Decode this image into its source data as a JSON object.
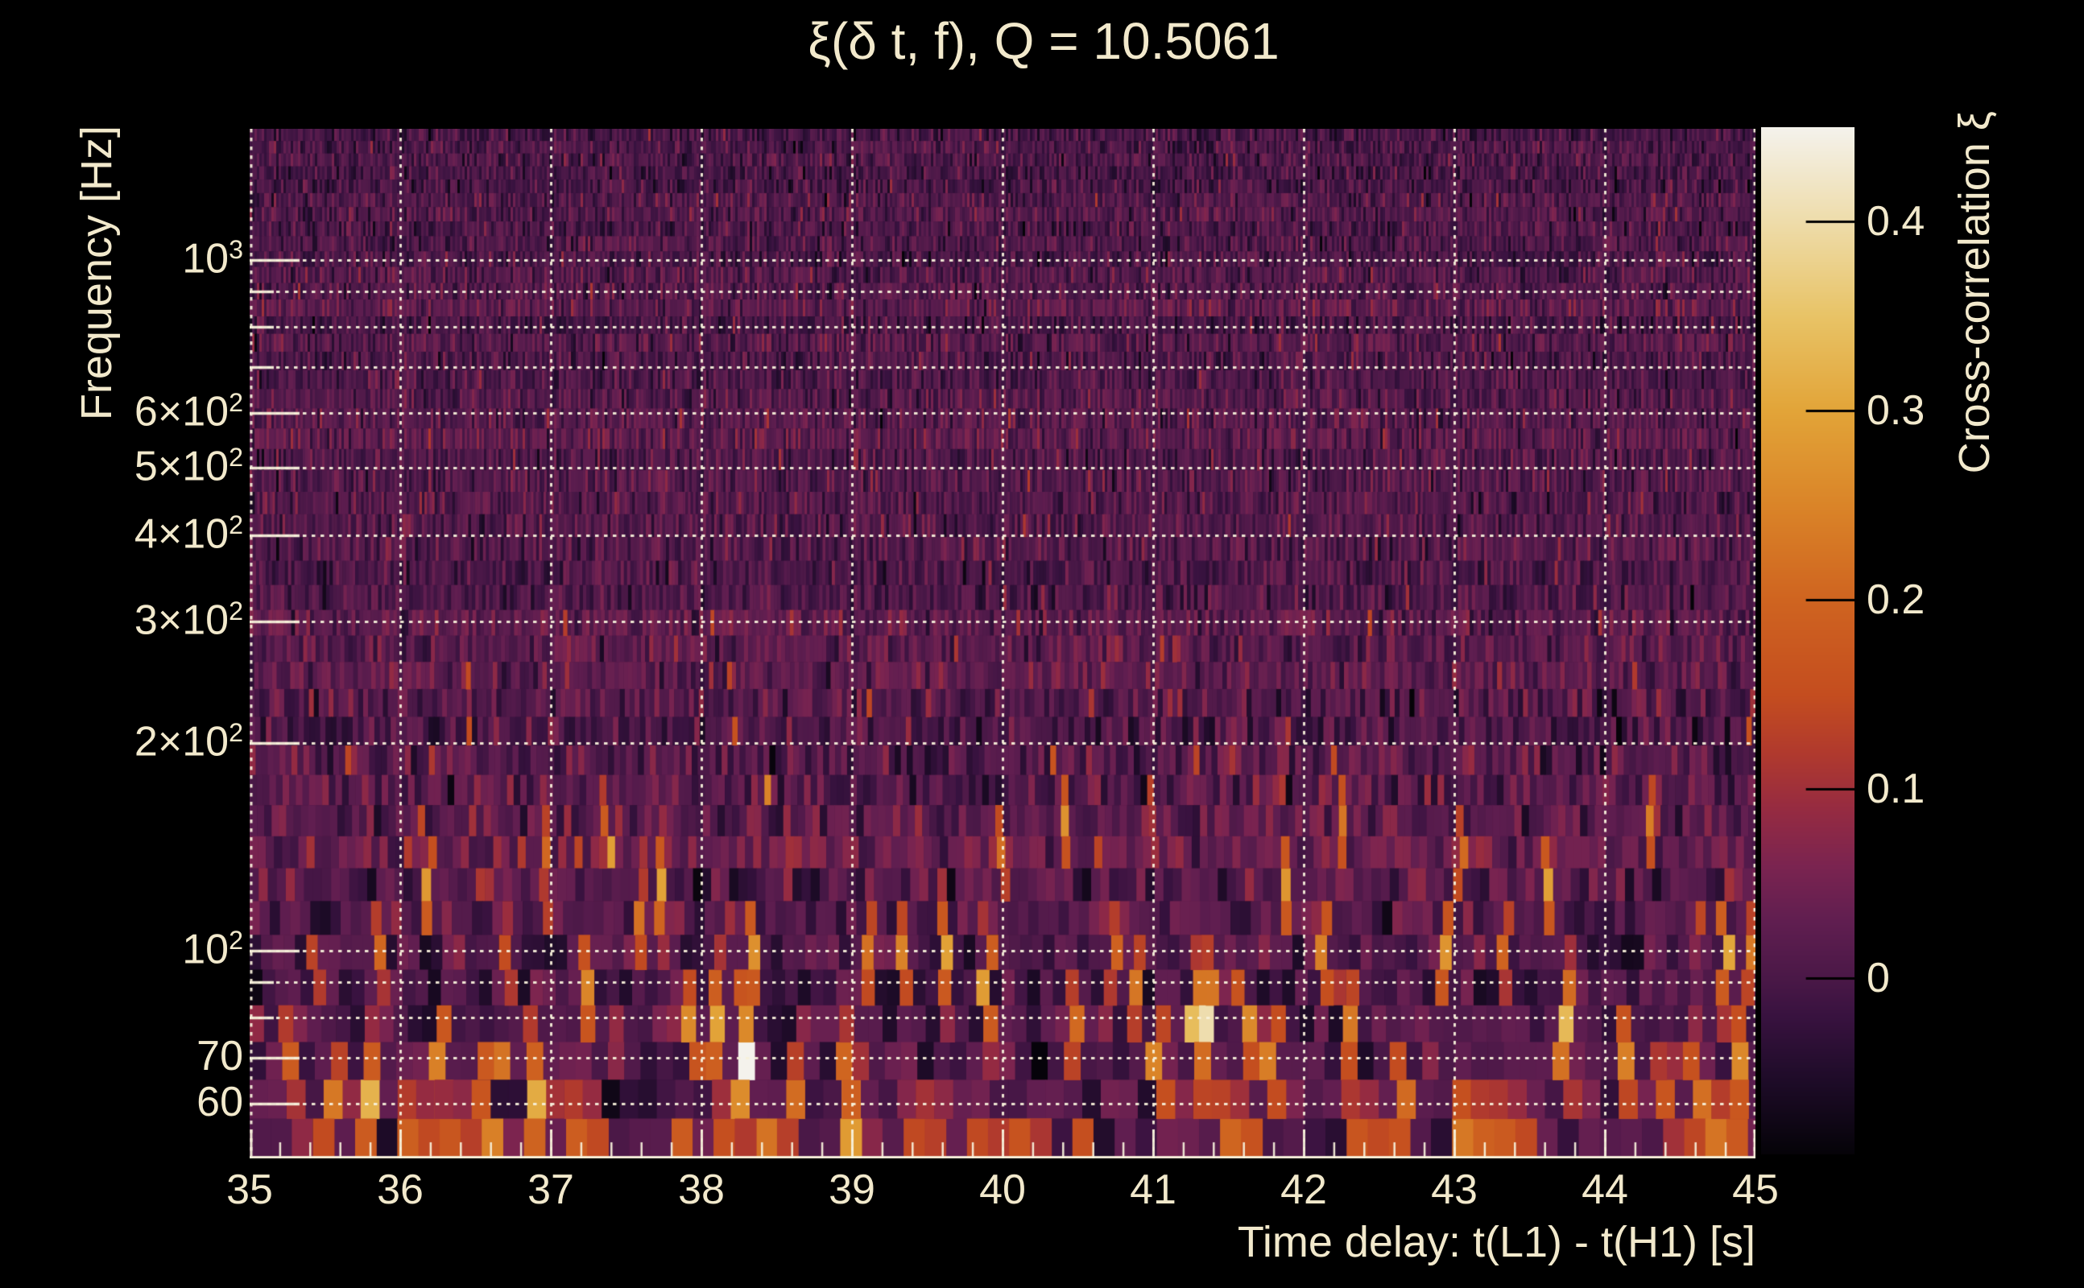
{
  "page": {
    "background": "#000000",
    "text_color": "#f2e9cc"
  },
  "chart_data": {
    "type": "heatmap",
    "title": "ξ(δ t, f), Q = 10.5061",
    "xlabel": "Time delay: t(L1) - t(H1) [s]",
    "ylabel": "Frequency [Hz]",
    "colorbar_label": "Cross-correlation ξ",
    "x_axis": {
      "min": 35,
      "max": 45,
      "scale": "linear",
      "major_ticks": [
        35,
        36,
        37,
        38,
        39,
        40,
        41,
        42,
        43,
        44,
        45
      ],
      "minor_tick_step": 0.2,
      "grid": true
    },
    "y_axis": {
      "min": 50,
      "max": 1550,
      "scale": "log",
      "ticks": [
        {
          "f": 1000,
          "base": "10",
          "sup": "3"
        },
        {
          "f": 600,
          "base": "6×10",
          "sup": "2"
        },
        {
          "f": 500,
          "base": "5×10",
          "sup": "2"
        },
        {
          "f": 400,
          "base": "4×10",
          "sup": "2"
        },
        {
          "f": 300,
          "base": "3×10",
          "sup": "2"
        },
        {
          "f": 200,
          "base": "2×10",
          "sup": "2"
        },
        {
          "f": 100,
          "base": "10",
          "sup": "2"
        },
        {
          "f": 70,
          "base": "70"
        },
        {
          "f": 60,
          "base": "60"
        }
      ],
      "gridline_freqs": [
        1000,
        900,
        800,
        700,
        600,
        500,
        400,
        300,
        200,
        100,
        90,
        80,
        70,
        60
      ],
      "labeled_freqs": [
        1000,
        600,
        500,
        400,
        300,
        200,
        100,
        70,
        60
      ],
      "grid": true
    },
    "colorbar": {
      "vmin": -0.093,
      "vmax": 0.45,
      "ticks": [
        {
          "v": 0.4,
          "label": "0.4"
        },
        {
          "v": 0.3,
          "label": "0.3"
        },
        {
          "v": 0.2,
          "label": "0.2"
        },
        {
          "v": 0.1,
          "label": "0.1"
        },
        {
          "v": 0.0,
          "label": "0"
        }
      ]
    },
    "colormap_name": "inferno-like",
    "colormap": [
      [
        -0.093,
        "#050308"
      ],
      [
        -0.055,
        "#1d0b27"
      ],
      [
        -0.02,
        "#38123f"
      ],
      [
        0.0,
        "#4a1847"
      ],
      [
        0.03,
        "#601e50"
      ],
      [
        0.06,
        "#7b2450"
      ],
      [
        0.09,
        "#962b41"
      ],
      [
        0.12,
        "#b13a2d"
      ],
      [
        0.15,
        "#c44d1f"
      ],
      [
        0.2,
        "#cf6420"
      ],
      [
        0.25,
        "#da8428"
      ],
      [
        0.3,
        "#e2a438"
      ],
      [
        0.35,
        "#e8c366"
      ],
      [
        0.4,
        "#eedcaa"
      ],
      [
        0.45,
        "#f4f2ec"
      ]
    ],
    "noise_field": {
      "seed": 20151226,
      "base_mean": 0.012,
      "sigma_high_freq": 0.03,
      "sigma_low_freq": 0.036,
      "low_freq_threshold": 230,
      "random_event_prob": 0.012,
      "rows": 44,
      "row_growth": 1.028
    },
    "events": [
      [
        35.25,
        70,
        0.18
      ],
      [
        35.55,
        62,
        0.22
      ],
      [
        35.8,
        60,
        0.3
      ],
      [
        35.85,
        95,
        0.2
      ],
      [
        36.0,
        53,
        0.18
      ],
      [
        36.2,
        125,
        0.27
      ],
      [
        36.25,
        65,
        0.26
      ],
      [
        36.35,
        53,
        0.16
      ],
      [
        36.55,
        57,
        0.24
      ],
      [
        36.7,
        100,
        0.16
      ],
      [
        36.9,
        60,
        0.3
      ],
      [
        36.95,
        140,
        0.2
      ],
      [
        37.15,
        53,
        0.18
      ],
      [
        37.25,
        90,
        0.26
      ],
      [
        37.35,
        150,
        0.18
      ],
      [
        37.6,
        110,
        0.22
      ],
      [
        37.75,
        130,
        0.3
      ],
      [
        37.95,
        75,
        0.26
      ],
      [
        38.1,
        80,
        0.3
      ],
      [
        38.15,
        53,
        0.16
      ],
      [
        38.3,
        70,
        0.44
      ],
      [
        38.35,
        100,
        0.28
      ],
      [
        38.6,
        58,
        0.22
      ],
      [
        38.95,
        62,
        0.33
      ],
      [
        39.05,
        57,
        0.3
      ],
      [
        39.1,
        95,
        0.22
      ],
      [
        39.1,
        235,
        0.14
      ],
      [
        39.35,
        105,
        0.25
      ],
      [
        39.45,
        53,
        0.16
      ],
      [
        39.6,
        95,
        0.29
      ],
      [
        39.8,
        53,
        0.15
      ],
      [
        39.9,
        85,
        0.3
      ],
      [
        40.0,
        140,
        0.22
      ],
      [
        40.1,
        53,
        0.14
      ],
      [
        40.4,
        150,
        0.26
      ],
      [
        40.45,
        75,
        0.22
      ],
      [
        40.75,
        95,
        0.2
      ],
      [
        40.9,
        85,
        0.22
      ],
      [
        41.05,
        70,
        0.24
      ],
      [
        41.3,
        80,
        0.33
      ],
      [
        41.35,
        75,
        0.38
      ],
      [
        41.45,
        53,
        0.2
      ],
      [
        41.6,
        75,
        0.26
      ],
      [
        41.8,
        65,
        0.24
      ],
      [
        41.9,
        130,
        0.27
      ],
      [
        42.15,
        95,
        0.24
      ],
      [
        42.25,
        160,
        0.25
      ],
      [
        42.3,
        75,
        0.24
      ],
      [
        42.3,
        53,
        0.18
      ],
      [
        42.65,
        60,
        0.22
      ],
      [
        42.95,
        95,
        0.27
      ],
      [
        43.0,
        55,
        0.24
      ],
      [
        43.05,
        140,
        0.22
      ],
      [
        43.3,
        55,
        0.18
      ],
      [
        43.35,
        100,
        0.2
      ],
      [
        43.6,
        120,
        0.28
      ],
      [
        43.75,
        80,
        0.32
      ],
      [
        44.1,
        70,
        0.24
      ],
      [
        44.3,
        150,
        0.25
      ],
      [
        44.4,
        60,
        0.18
      ],
      [
        44.6,
        62,
        0.22
      ],
      [
        44.75,
        53,
        0.22
      ],
      [
        44.8,
        95,
        0.3
      ],
      [
        44.85,
        65,
        0.26
      ],
      [
        44.95,
        100,
        0.24
      ],
      [
        36.45,
        250,
        0.12
      ],
      [
        37.1,
        300,
        0.11
      ],
      [
        38.2,
        260,
        0.13
      ],
      [
        39.5,
        230,
        0.11
      ],
      [
        40.6,
        230,
        0.12
      ],
      [
        41.15,
        280,
        0.11
      ],
      [
        42.45,
        300,
        0.12
      ],
      [
        43.3,
        260,
        0.11
      ],
      [
        44.2,
        240,
        0.11
      ],
      [
        36.2,
        480,
        0.1
      ],
      [
        39.2,
        420,
        0.1
      ],
      [
        41.7,
        520,
        0.09
      ],
      [
        43.9,
        460,
        0.09
      ]
    ]
  }
}
